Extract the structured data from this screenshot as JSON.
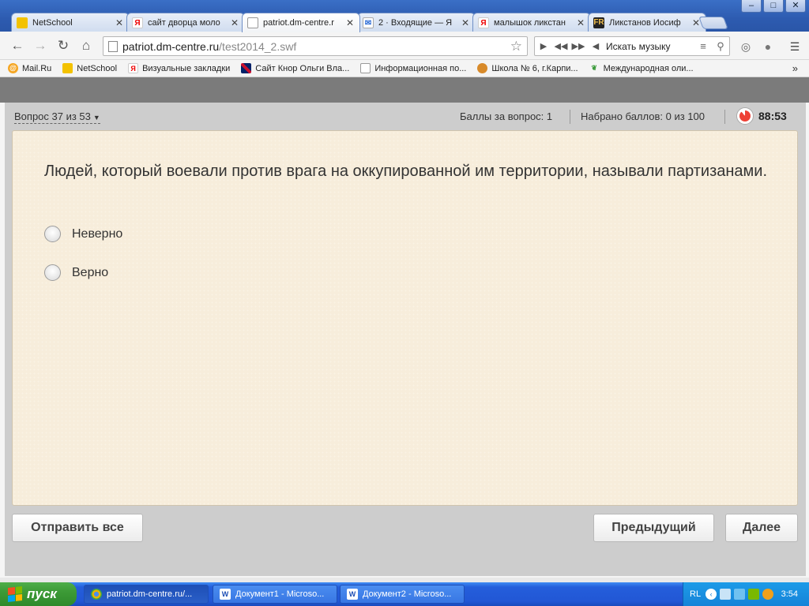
{
  "browser": {
    "tabs": [
      {
        "title": "NetSchool",
        "active": false,
        "icon": "netschool-icon"
      },
      {
        "title": "сайт дворца моло",
        "active": false,
        "icon": "yandex-icon"
      },
      {
        "title": "patriot.dm-centre.r",
        "active": true,
        "icon": "page-icon"
      },
      {
        "title": "2 · Входящие — Я",
        "active": false,
        "icon": "mail-icon"
      },
      {
        "title": "малышок ликстан",
        "active": false,
        "icon": "yandex-icon"
      },
      {
        "title": "Ликстанов Иосиф",
        "active": false,
        "icon": "fr-icon"
      }
    ],
    "window_buttons": {
      "minimize": "–",
      "maximize": "□",
      "close": "✕"
    },
    "url_host": "patriot.dm-centre.ru",
    "url_path": "/test2014_2.swf",
    "music_search_label": "Искать музыку",
    "bookmarks": [
      {
        "label": "Mail.Ru",
        "icon": "mailru-icon"
      },
      {
        "label": "NetSchool",
        "icon": "netschool-icon"
      },
      {
        "label": "Визуальные закладки",
        "icon": "yandex-icon"
      },
      {
        "label": "Сайт Кнор Ольги Вла...",
        "icon": "uk-flag-icon"
      },
      {
        "label": "Информационная по...",
        "icon": "page-icon"
      },
      {
        "label": "Школа № 6, г.Карпи...",
        "icon": "school-icon"
      },
      {
        "label": "Международная оли...",
        "icon": "leaf-icon"
      }
    ],
    "bookmarks_more": "»"
  },
  "quiz": {
    "question_counter": "Вопрос 37 из 53",
    "points_per_question": "Баллы за вопрос: 1",
    "points_total": "Набрано баллов: 0 из 100",
    "timer": "88:53",
    "question_text": "Людей, который воевали против врага на оккупированной им территории, называли партизанами.",
    "answers": [
      "Неверно",
      "Верно"
    ],
    "buttons": {
      "submit_all": "Отправить все",
      "previous": "Предыдущий",
      "next": "Далее"
    }
  },
  "taskbar": {
    "start_label": "пуск",
    "tasks": [
      {
        "label": "patriot.dm-centre.ru/...",
        "icon": "chrome-icon",
        "active": true
      },
      {
        "label": "Документ1 - Microso...",
        "icon": "word-icon",
        "active": false
      },
      {
        "label": "Документ2 - Microso...",
        "icon": "word-icon",
        "active": false
      }
    ],
    "language": "RL",
    "clock": "3:54"
  }
}
